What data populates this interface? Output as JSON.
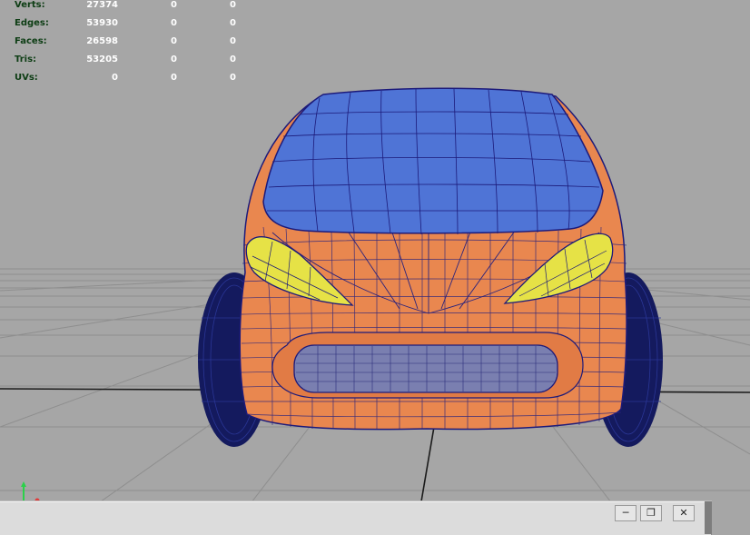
{
  "hud": {
    "rows": [
      {
        "label": "Verts:",
        "v0": "27374",
        "v1": "0",
        "v2": "0"
      },
      {
        "label": "Edges:",
        "v0": "53930",
        "v1": "0",
        "v2": "0"
      },
      {
        "label": "Faces:",
        "v0": "26598",
        "v1": "0",
        "v2": "0"
      },
      {
        "label": "Tris:",
        "v0": "53205",
        "v1": "0",
        "v2": "0"
      },
      {
        "label": "UVs:",
        "v0": "0",
        "v1": "0",
        "v2": "0"
      }
    ]
  },
  "window": {
    "status_text": "",
    "minimize_icon": "minimize-icon",
    "restore_icon": "restore-icon",
    "close_icon": "close-icon"
  },
  "colors": {
    "viewport_bg": "#a6a6a6",
    "body_orange": "#e9874f",
    "windshield_blue": "#4f74d6",
    "headlight_yellow": "#e6e246",
    "wire": "#1c1a7a"
  }
}
